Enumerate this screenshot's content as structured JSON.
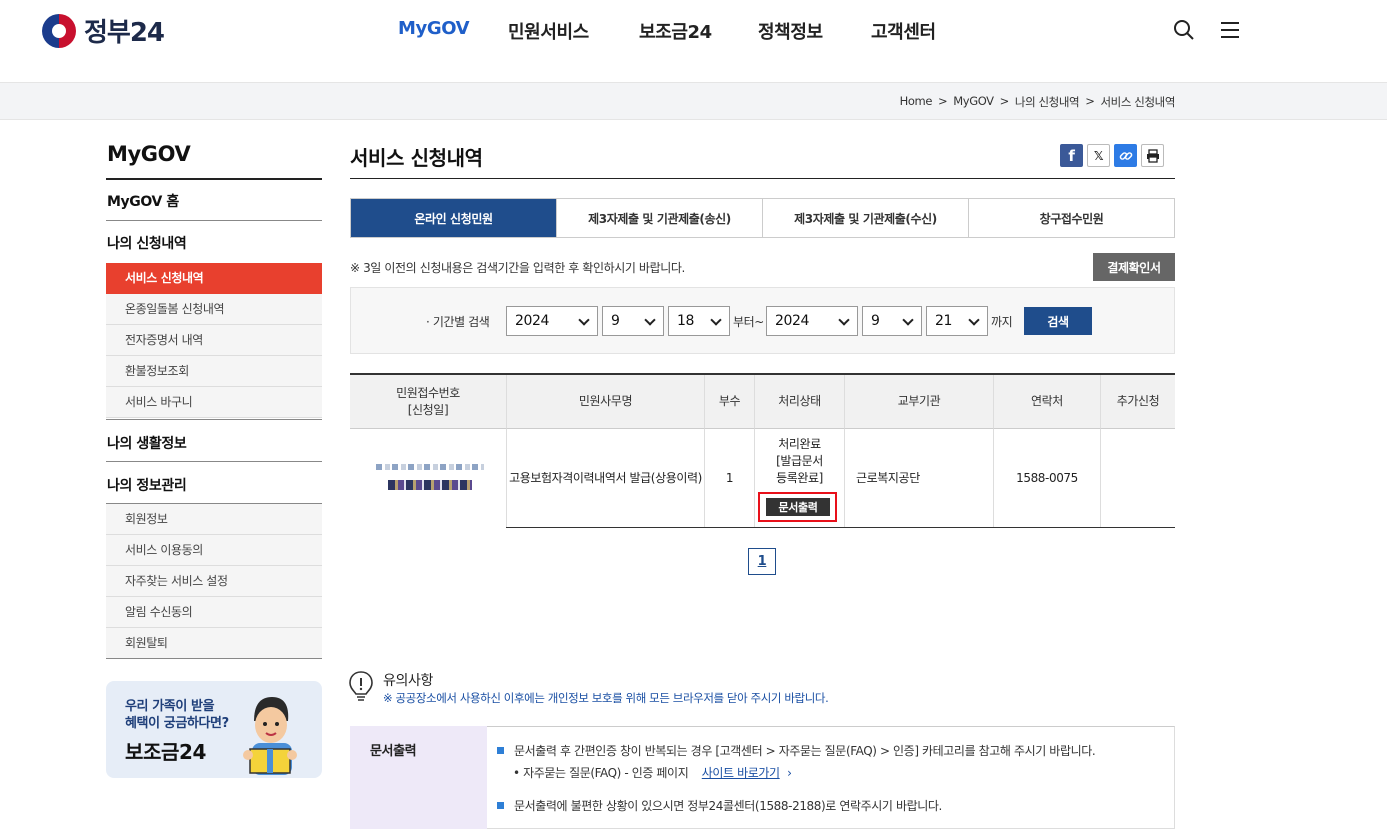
{
  "header": {
    "logo_text": "정부24",
    "nav": [
      "MyGOV",
      "민원서비스",
      "보조금24",
      "정책정보",
      "고객센터"
    ],
    "active_nav": "MyGOV",
    "active_color": "#1f5fc9"
  },
  "breadcrumb": [
    "Home",
    "MyGOV",
    "나의 신청내역",
    "서비스 신청내역"
  ],
  "sidebar": {
    "title": "MyGOV",
    "home": "MyGOV 홈",
    "group1": {
      "label": "나의 신청내역",
      "items": [
        "서비스 신청내역",
        "온종일돌봄 신청내역",
        "전자증명서 내역",
        "환불정보조회",
        "서비스 바구니"
      ]
    },
    "group2": {
      "label": "나의 생활정보"
    },
    "group3": {
      "label": "나의 정보관리",
      "items": [
        "회원정보",
        "서비스 이용동의",
        "자주찾는 서비스 설정",
        "알림 수신동의",
        "회원탈퇴"
      ]
    },
    "banner": {
      "line1": "우리 가족이 받을",
      "line2": "혜택이 궁금하다면?",
      "title": "보조금24"
    }
  },
  "main": {
    "title": "서비스 신청내역",
    "share_icons": [
      "facebook-icon",
      "x-icon",
      "link-icon",
      "print-icon"
    ],
    "tabs": [
      "온라인 신청민원",
      "제3자제출 및 기관제출(송신)",
      "제3자제출 및 기관제출(수신)",
      "창구접수민원"
    ],
    "notice": "※ 3일 이전의 신청내용은 검색기간을 입력한 후 확인하시기 바랍니다.",
    "receipt_button": "결제확인서",
    "search": {
      "label": "· 기간별 검색",
      "from_year": "2024",
      "from_month": "9",
      "from_day": "18",
      "from_suffix": "부터~",
      "to_year": "2024",
      "to_month": "9",
      "to_day": "21",
      "to_suffix": "까지",
      "button": "검색"
    },
    "table": {
      "headers": [
        "민원접수번호\n[신청일]",
        "민원사무명",
        "부수",
        "처리상태",
        "교부기관",
        "연락처",
        "추가신청"
      ],
      "rows": [
        {
          "service": "고용보험자격이력내역서 발급(상용이력)",
          "count": "1",
          "status": "처리완료\n[발급문서\n등록완료]",
          "print_button": "문서출력",
          "agency": "근로복지공단",
          "phone": "1588-0075",
          "extra": ""
        }
      ]
    },
    "pagination": {
      "current": "1"
    }
  },
  "notice_section": {
    "title": "유의사항",
    "subtitle": "※ 공공장소에서 사용하신 이후에는 개인정보 보호를 위해 모든 브라우저를 닫아 주시기 바랍니다.",
    "box_title": "문서출력",
    "bullet1": "문서출력 후 간편인증 창이 반복되는 경우 [고객센터 > 자주묻는 질문(FAQ) > 인증] 카테고리를 참고해 주시기 바랍니다.",
    "sub_bullet": "• 자주묻는 질문(FAQ) - 인증 페이지",
    "link": "사이트 바로가기",
    "bullet2": "문서출력에 불편한 상황이 있으시면 정부24콜센터(1588-2188)로 연락주시기 바랍니다."
  }
}
